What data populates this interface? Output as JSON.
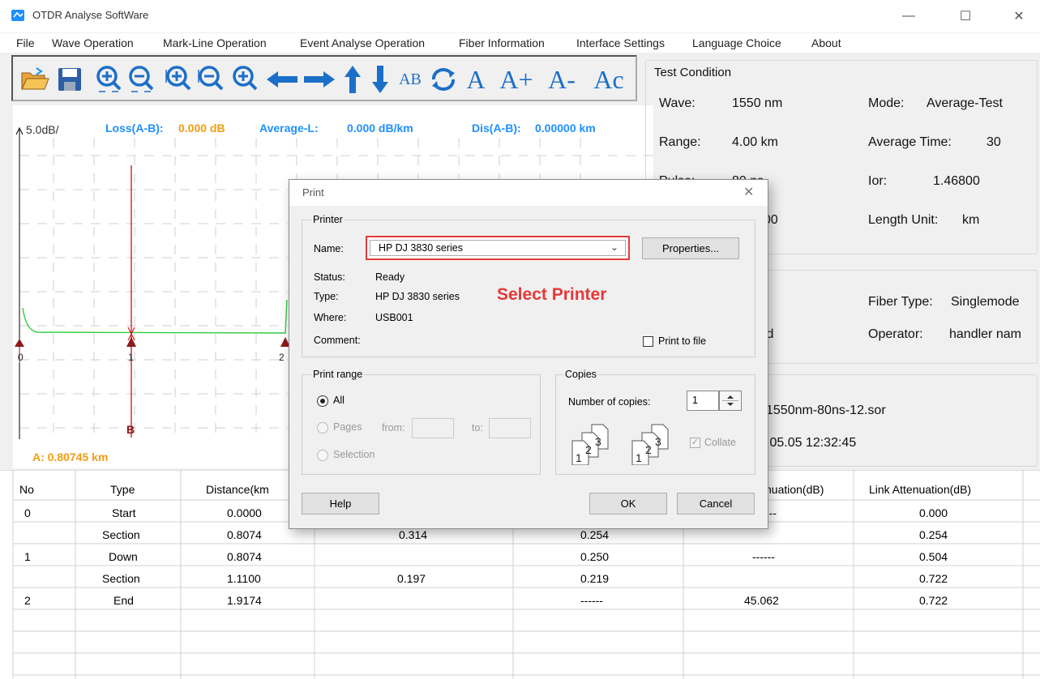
{
  "window": {
    "title": "OTDR Analyse SoftWare",
    "minimize_glyph": "—",
    "maximize_glyph": "☐",
    "close_glyph": "✕"
  },
  "menu": [
    "File",
    "Wave Operation",
    "Mark-Line Operation",
    "Event Analyse Operation",
    "Fiber Information",
    "Interface Settings",
    "Language Choice",
    "About"
  ],
  "toolbar": {
    "text_buttons": [
      "AB",
      "A",
      "A+",
      "A-",
      "Ac"
    ],
    "icons": [
      "open-folder-icon",
      "save-disk-icon",
      "zoom-in-horizontal-icon",
      "zoom-out-horizontal-icon",
      "zoom-in-vertical-icon",
      "zoom-out-vertical-icon",
      "zoom-reset-icon",
      "arrow-left-icon",
      "arrow-right-icon",
      "arrow-up-icon",
      "arrow-down-icon",
      "swap-ab-icon",
      "refresh-icon",
      "marker-a-icon",
      "marker-a-plus-icon",
      "marker-a-minus-icon",
      "marker-a-center-icon"
    ]
  },
  "chart": {
    "scale": "5.0dB/",
    "loss_label": "Loss(A-B):",
    "loss_value": "0.000 dB",
    "avg_label": "Average-L:",
    "avg_value": "0.000 dB/km",
    "dis_label": "Dis(A-B):",
    "dis_value": "0.00000 km",
    "markers": [
      "0",
      "1",
      "2"
    ],
    "cursor_label": "B",
    "position": "A: 0.80745 km"
  },
  "test_condition": {
    "title": "Test Condition",
    "wave_label": "Wave:",
    "wave_value": "1550 nm",
    "mode_label": "Mode:",
    "mode_value": "Average-Test",
    "range_label": "Range:",
    "range_value": "4.00 km",
    "avg_time_label": "Average Time:",
    "avg_time_value": "30",
    "pulse_label": "Pulse:",
    "pulse_value": "80 ns",
    "ior_label": "Ior:",
    "ior_value": "1.46800",
    "partial_value": "00",
    "length_unit_label": "Length Unit:",
    "length_unit_value": "km"
  },
  "fiber_info": {
    "partial": "id",
    "fiber_type_label": "Fiber Type:",
    "fiber_type_value": "Singlemode",
    "operator_label": "Operator:",
    "operator_value": "handler nam"
  },
  "file_info": {
    "filename_partial": "1550nm-80ns-12.sor",
    "datetime_partial": ".05.05  12:32:45"
  },
  "table": {
    "headers": [
      "No",
      "Type",
      "Distance(km",
      "",
      "",
      "nuation(dB)",
      "Link Attenuation(dB)"
    ],
    "rows": [
      [
        "0",
        "Start",
        "0.0000",
        "",
        "",
        "---",
        "0.000"
      ],
      [
        "",
        "Section",
        "0.8074",
        "0.314",
        "0.254",
        "",
        "0.254"
      ],
      [
        "1",
        "Down",
        "0.8074",
        "",
        "0.250",
        "------",
        "0.504"
      ],
      [
        "",
        "Section",
        "1.1100",
        "0.197",
        "0.219",
        "",
        "0.722"
      ],
      [
        "2",
        "End",
        "1.9174",
        "",
        "------",
        "45.062",
        "0.722"
      ]
    ]
  },
  "dialog": {
    "title": "Print",
    "close_glyph": "✕",
    "printer_group": "Printer",
    "name_label": "Name:",
    "name_value": "HP DJ 3830 series",
    "properties_button": "Properties...",
    "status_label": "Status:",
    "status_value": "Ready",
    "type_label": "Type:",
    "type_value": "HP DJ 3830 series",
    "where_label": "Where:",
    "where_value": "USB001",
    "comment_label": "Comment:",
    "print_to_file": "Print to file",
    "annotation": "Select Printer",
    "range_group": "Print range",
    "range_all": "All",
    "range_pages": "Pages",
    "from_label": "from:",
    "to_label": "to:",
    "range_selection": "Selection",
    "copies_group": "Copies",
    "copies_label": "Number of copies:",
    "copies_value": "1",
    "collate_label": "Collate",
    "help_button": "Help",
    "ok_button": "OK",
    "cancel_button": "Cancel"
  },
  "colors": {
    "accent_orange": "#f39c12",
    "accent_blue": "#1e90ff",
    "annotation_red": "#e83737",
    "trace_green": "#2ecc40",
    "marker_red": "#8b1a1a"
  }
}
